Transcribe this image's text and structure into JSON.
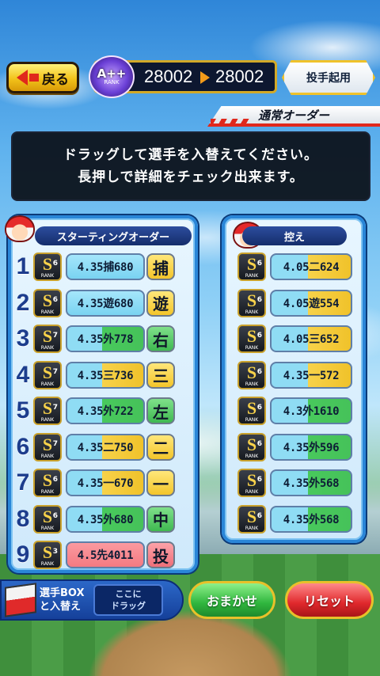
{
  "header": {
    "back_label": "戻る",
    "rank_label": "A++",
    "rank_sub": "RANK",
    "score_before": "28002",
    "score_after": "28002",
    "pitcher_button_label": "投手起用",
    "order_tab_label": "通常オーダー"
  },
  "instructions": {
    "line1": "ドラッグして選手を入替えてください。",
    "line2": "長押しで詳細をチェック出来ます。"
  },
  "starting": {
    "title": "スターティングオーダー",
    "players": [
      {
        "order": "1",
        "rank": "S",
        "sub": "6",
        "stat": "4.35捕680",
        "pos": "捕",
        "stat_color": "c-cyan",
        "pos_color": "c-yellow"
      },
      {
        "order": "2",
        "rank": "S",
        "sub": "6",
        "stat": "4.35遊680",
        "pos": "遊",
        "stat_color": "c-cyan",
        "pos_color": "c-yellow"
      },
      {
        "order": "3",
        "rank": "S",
        "sub": "7",
        "stat": "4.35外778",
        "pos": "右",
        "stat_color": "c-green",
        "pos_color": "c-green"
      },
      {
        "order": "4",
        "rank": "S",
        "sub": "7",
        "stat": "4.35三736",
        "pos": "三",
        "stat_color": "c-yellow",
        "pos_color": "c-yellow"
      },
      {
        "order": "5",
        "rank": "S",
        "sub": "7",
        "stat": "4.35外722",
        "pos": "左",
        "stat_color": "c-green",
        "pos_color": "c-green"
      },
      {
        "order": "6",
        "rank": "S",
        "sub": "7",
        "stat": "4.35二750",
        "pos": "二",
        "stat_color": "c-yellow",
        "pos_color": "c-yellow"
      },
      {
        "order": "7",
        "rank": "S",
        "sub": "6",
        "stat": "4.35一670",
        "pos": "一",
        "stat_color": "c-yellow",
        "pos_color": "c-yellow"
      },
      {
        "order": "8",
        "rank": "S",
        "sub": "6",
        "stat": "4.35外680",
        "pos": "中",
        "stat_color": "c-green",
        "pos_color": "c-green"
      },
      {
        "order": "9",
        "rank": "S",
        "sub": "3",
        "stat": "4.5先4011",
        "pos": "投",
        "stat_color": "c-pink",
        "pos_color": "c-pink"
      }
    ]
  },
  "bench": {
    "title": "控え",
    "players": [
      {
        "rank": "S",
        "sub": "6",
        "stat": "4.05二624",
        "stat_color": "c-yellow"
      },
      {
        "rank": "S",
        "sub": "6",
        "stat": "4.05遊554",
        "stat_color": "c-yellow"
      },
      {
        "rank": "S",
        "sub": "6",
        "stat": "4.05三652",
        "stat_color": "c-yellow"
      },
      {
        "rank": "S",
        "sub": "6",
        "stat": "4.35一572",
        "stat_color": "c-yellow"
      },
      {
        "rank": "S",
        "sub": "6",
        "stat": "4.3外1610",
        "stat_color": "c-green"
      },
      {
        "rank": "S",
        "sub": "6",
        "stat": "4.35外596",
        "stat_color": "c-green"
      },
      {
        "rank": "S",
        "sub": "6",
        "stat": "4.35外568",
        "stat_color": "c-green"
      },
      {
        "rank": "S",
        "sub": "6",
        "stat": "4.35外568",
        "stat_color": "c-green"
      }
    ]
  },
  "rank_caption": "RANK",
  "footer": {
    "box_label_line1": "選手BOX",
    "box_label_line2": "と入替え",
    "drop_line1": "ここに",
    "drop_line2": "ドラッグ",
    "omakase_label": "おまかせ",
    "reset_label": "リセット"
  }
}
